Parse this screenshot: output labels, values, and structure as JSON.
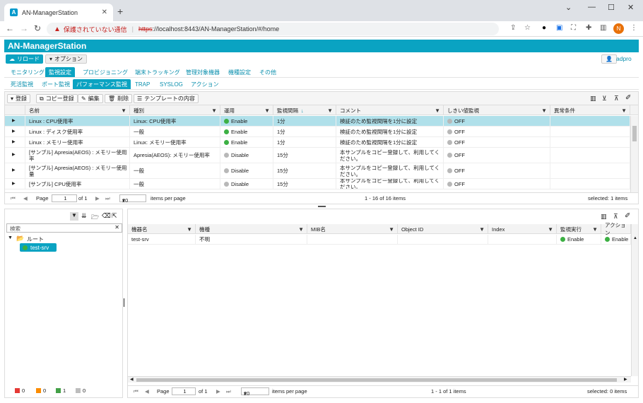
{
  "browser": {
    "tab_title": "AN-ManagerStation",
    "tab_icon": "A",
    "insecure_label": "保護されていない通信",
    "url_scheme": "https",
    "url_rest": "://localhost:8443/AN-ManagerStation/#/home",
    "profile_initial": "N"
  },
  "app": {
    "title": "AN-ManagerStation",
    "reload_label": "リロード",
    "options_label": "オプション",
    "user": "adpro"
  },
  "nav_main": [
    "モニタリング",
    "監視設定",
    "プロビジョニング",
    "端末トラッキング",
    "管理対象機器",
    "機種設定",
    "その他"
  ],
  "nav_sub": [
    "死活監視",
    "ポート監視",
    "パフォーマンス監視",
    "TRAP",
    "SYSLOG",
    "アクション"
  ],
  "toolbar": {
    "register": "登録",
    "copy_register": "コピー登録",
    "edit": "編集",
    "delete": "削除",
    "template": "テンプレートの内容"
  },
  "top_grid": {
    "columns": [
      "名前",
      "種別",
      "運用",
      "監視間隔",
      "コメント",
      "しきい値監視",
      "異常条件"
    ],
    "rows": [
      {
        "name": "Linux : CPU使用率",
        "type": "Linux: CPU使用率",
        "op": "Enable",
        "interval": "1分",
        "comment": "検証のため監視間隔を1分に設定",
        "threshold": "OFF",
        "cond": ""
      },
      {
        "name": "Linux : ディスク使用率",
        "type": "一般",
        "op": "Enable",
        "interval": "1分",
        "comment": "検証のため監視間隔を1分に設定",
        "threshold": "OFF",
        "cond": ""
      },
      {
        "name": "Linux : メモリー使用率",
        "type": "Linux: メモリー使用率",
        "op": "Enable",
        "interval": "1分",
        "comment": "検証のため監視間隔を1分に設定",
        "threshold": "OFF",
        "cond": ""
      },
      {
        "name": "[サンプル] Apresia(AEOS) : メモリー使用率",
        "type": "Apresia(AEOS): メモリー使用率",
        "op": "Disable",
        "interval": "15分",
        "comment": "本サンプルをコピー登録して、利用してください。",
        "threshold": "OFF",
        "cond": ""
      },
      {
        "name": "[サンプル] Apresia(AEOS) : メモリー使用量",
        "type": "一般",
        "op": "Disable",
        "interval": "15分",
        "comment": "本サンプルをコピー登録して、利用してください。",
        "threshold": "OFF",
        "cond": ""
      },
      {
        "name": "[サンプル] CPU使用率",
        "type": "一般",
        "op": "Disable",
        "interval": "15分",
        "comment": "本サンプルをコピー登録して、利用してください。",
        "threshold": "OFF",
        "cond": ""
      }
    ],
    "pager": {
      "page_label": "Page",
      "page": "1",
      "of": "of 1",
      "per_page": "20",
      "per_page_label": "items per page",
      "range": "1 - 16 of 16 items",
      "selected": "selected: 1 items"
    }
  },
  "left_pane": {
    "search_placeholder": "検索",
    "root_label": "ルート",
    "node_label": "test-srv",
    "counts": [
      "0",
      "0",
      "1",
      "0"
    ],
    "count_colors": [
      "#e53935",
      "#fb8c00",
      "#43a047",
      "#bdbdbd"
    ]
  },
  "bottom_grid": {
    "columns": [
      "機器名",
      "機種",
      "MIB名",
      "Object ID",
      "Index",
      "監視実行",
      "アクション"
    ],
    "rows": [
      {
        "device": "test-srv",
        "model": "不明",
        "mib": "",
        "oid": "",
        "index": "",
        "exec": "Enable",
        "action": "Enable"
      }
    ],
    "pager": {
      "page_label": "Page",
      "page": "1",
      "of": "of 1",
      "per_page": "20",
      "per_page_label": "items per page",
      "range": "1 - 1 of 1 items",
      "selected": "selected: 0 items"
    }
  }
}
